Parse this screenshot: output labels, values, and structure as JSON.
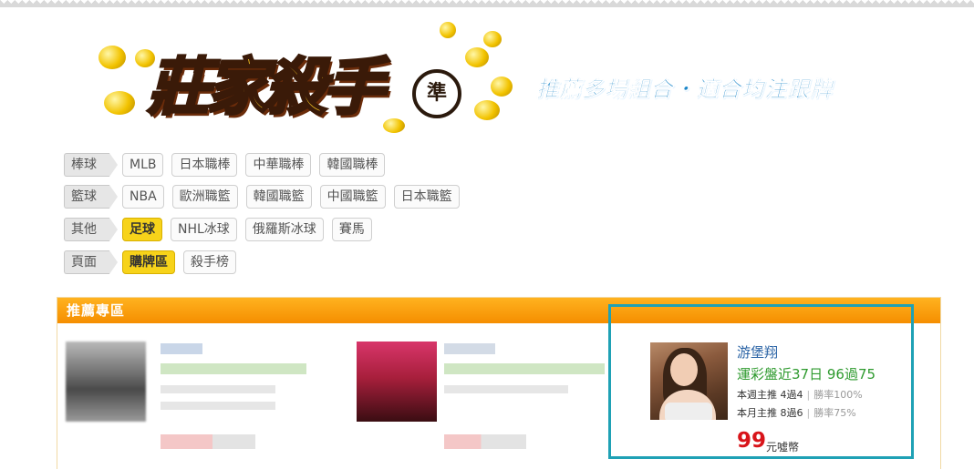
{
  "header": {
    "logo_text": "莊家殺手",
    "logo_badge": "準",
    "slogan": "推薦多場組合・適合均注跟牌"
  },
  "categories": [
    {
      "label": "棒球",
      "tags": [
        "MLB",
        "日本職棒",
        "中華職棒",
        "韓國職棒"
      ],
      "active": []
    },
    {
      "label": "籃球",
      "tags": [
        "NBA",
        "歐洲職籃",
        "韓國職籃",
        "中國職籃",
        "日本職籃"
      ],
      "active": []
    },
    {
      "label": "其他",
      "tags": [
        "足球",
        "NHL冰球",
        "俄羅斯冰球",
        "賽馬"
      ],
      "active": [
        0
      ]
    },
    {
      "label": "頁面",
      "tags": [
        "購牌區",
        "殺手榜"
      ],
      "active": [
        0
      ]
    }
  ],
  "panel": {
    "title": "推薦專區",
    "featured": {
      "name": "游堡翔",
      "record": "運彩盤近37日 96過75",
      "weekly_label": "本週主推 4過4",
      "weekly_rate": "勝率100%",
      "monthly_label": "本月主推 8過6",
      "monthly_rate": "勝率75%",
      "price": "99",
      "price_unit": "元噓幣"
    }
  },
  "colors": {
    "accent_orange": "#f58e00",
    "active_tag": "#f7d31a",
    "highlight": "#1fa1b5",
    "price_red": "#d8141a",
    "record_green": "#2e9a2e",
    "name_blue": "#2b64a6"
  }
}
